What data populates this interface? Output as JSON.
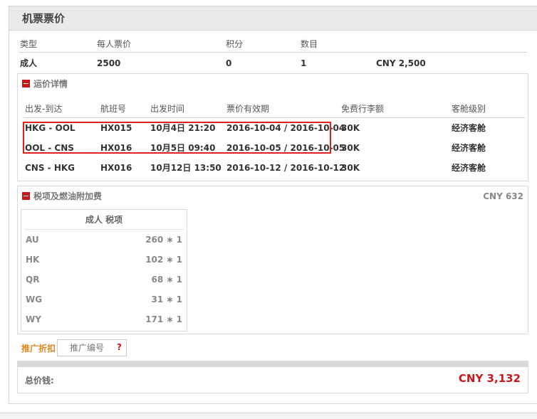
{
  "panel": {
    "title": "机票票价"
  },
  "summary": {
    "headers": [
      "类型",
      "每人票价",
      "积分",
      "数目"
    ],
    "row": {
      "type": "成人",
      "price": "2500",
      "points": "0",
      "count": "1",
      "total": "CNY 2,500"
    }
  },
  "fare": {
    "title": "运价详情",
    "headers": [
      "出发-到达",
      "航班号",
      "出发时间",
      "票价有效期",
      "免费行李额",
      "客舱级别"
    ],
    "rows": [
      {
        "route": "HKG - OOL",
        "flight": "HX015",
        "time": "10月4日 21:20",
        "validity": "2016-10-04 / 2016-10-04",
        "baggage": "30K",
        "cabin": "经济客舱"
      },
      {
        "route": "OOL - CNS",
        "flight": "HX016",
        "time": "10月5日 09:40",
        "validity": "2016-10-05 / 2016-10-05",
        "baggage": "30K",
        "cabin": "经济客舱"
      },
      {
        "route": "CNS - HKG",
        "flight": "HX016",
        "time": "10月12日 13:50",
        "validity": "2016-10-12 / 2016-10-12",
        "baggage": "30K",
        "cabin": "经济客舱"
      }
    ]
  },
  "tax": {
    "title": "税项及燃油附加费",
    "total": "CNY 632",
    "table_header": "成人 税项",
    "rows": [
      {
        "code": "AU",
        "amount": "260 ∗ 1"
      },
      {
        "code": "HK",
        "amount": "102 ∗ 1"
      },
      {
        "code": "QR",
        "amount": "68 ∗ 1"
      },
      {
        "code": "WG",
        "amount": "31 ∗ 1"
      },
      {
        "code": "WY",
        "amount": "171 ∗ 1"
      }
    ]
  },
  "promo": {
    "label": "推广折扣",
    "placeholder": "推广编号",
    "help": "?"
  },
  "total": {
    "label": "总价钱:",
    "value": "CNY 3,132"
  },
  "colors": {
    "accent_red": "#c8161d",
    "promo_orange": "#e0851a",
    "highlight_red": "#e02020"
  }
}
